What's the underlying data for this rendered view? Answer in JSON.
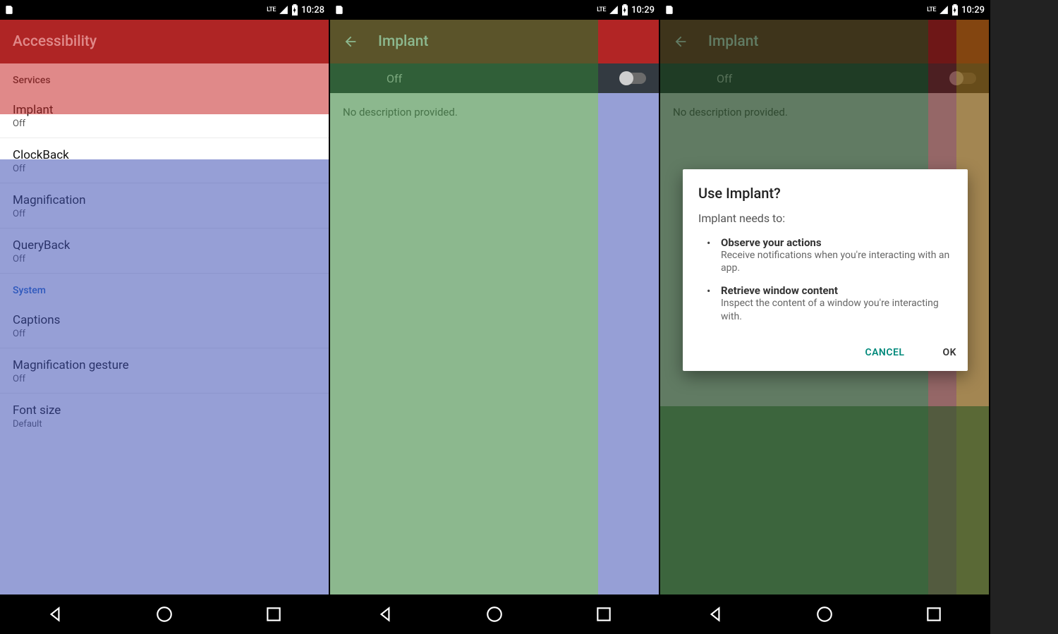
{
  "status": {
    "net": "LTE",
    "time1": "10:28",
    "time2": "10:29",
    "time3": "10:29"
  },
  "screen1": {
    "title": "Accessibility",
    "sectionServices": "Services",
    "sectionSystem": "System",
    "items": [
      {
        "title": "Implant",
        "sub": "Off"
      },
      {
        "title": "ClockBack",
        "sub": "Off"
      },
      {
        "title": "Magnification",
        "sub": "Off"
      },
      {
        "title": "QueryBack",
        "sub": "Off"
      },
      {
        "title": "Captions",
        "sub": "Off"
      },
      {
        "title": "Magnification gesture",
        "sub": "Off"
      },
      {
        "title": "Font size",
        "sub": "Default"
      }
    ]
  },
  "screen2": {
    "title": "Implant",
    "toggleLabel": "Off",
    "body": "No description provided."
  },
  "screen3": {
    "title": "Implant",
    "toggleLabel": "Off",
    "body": "No description provided.",
    "dialog": {
      "title": "Use Implant?",
      "lead": "Implant needs to:",
      "bullets": [
        {
          "t": "Observe your actions",
          "d": "Receive notifications when you're interacting with an app."
        },
        {
          "t": "Retrieve window content",
          "d": "Inspect the content of a window you're interacting with."
        }
      ],
      "cancel": "CANCEL",
      "ok": "OK"
    }
  }
}
